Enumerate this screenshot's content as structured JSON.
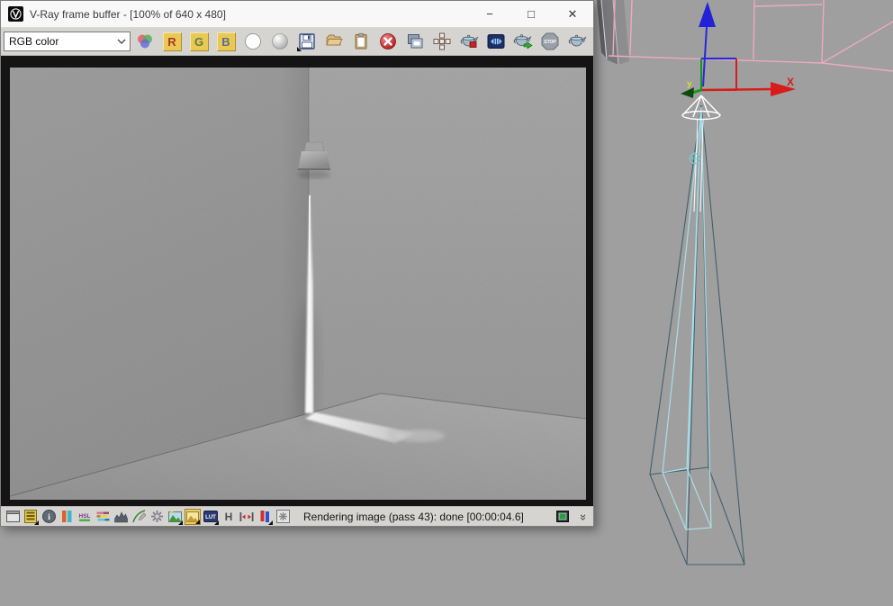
{
  "window": {
    "title": "V-Ray frame buffer - [100% of 640 x 480]",
    "controls": {
      "minimize": "−",
      "maximize": "□",
      "close": "✕"
    }
  },
  "toolbar": {
    "channel_select": {
      "value": "RGB color"
    },
    "red_label": "R",
    "green_label": "G",
    "blue_label": "B",
    "stop_label": "STOP"
  },
  "statusbar": {
    "message": "Rendering image (pass 43): done [00:00:04.6]",
    "hsl_label": "HSL",
    "lut_label": "LUT",
    "h_label": "H",
    "info_glyph": "i",
    "collapse_glyph": "»"
  },
  "viewport": {
    "axis_labels": {
      "x": "X",
      "y": "y"
    }
  },
  "colors": {
    "viewport_bg": "#9f9f9f",
    "titlebar_bg": "#f8f8f8",
    "toolbar_bg": "#d5d4d1",
    "status_bg": "#d5d4d1",
    "render_surround": "#141414",
    "channel_button_bg": "#e9c953",
    "gizmo_red": "#d81c1c",
    "gizmo_green": "#159915",
    "gizmo_blue": "#2727dd",
    "wire_pink": "#ecaabe",
    "wire_cyan": "#a9dee8",
    "wire_dark": "#41616c",
    "axis_y_label": "#d8d833"
  }
}
